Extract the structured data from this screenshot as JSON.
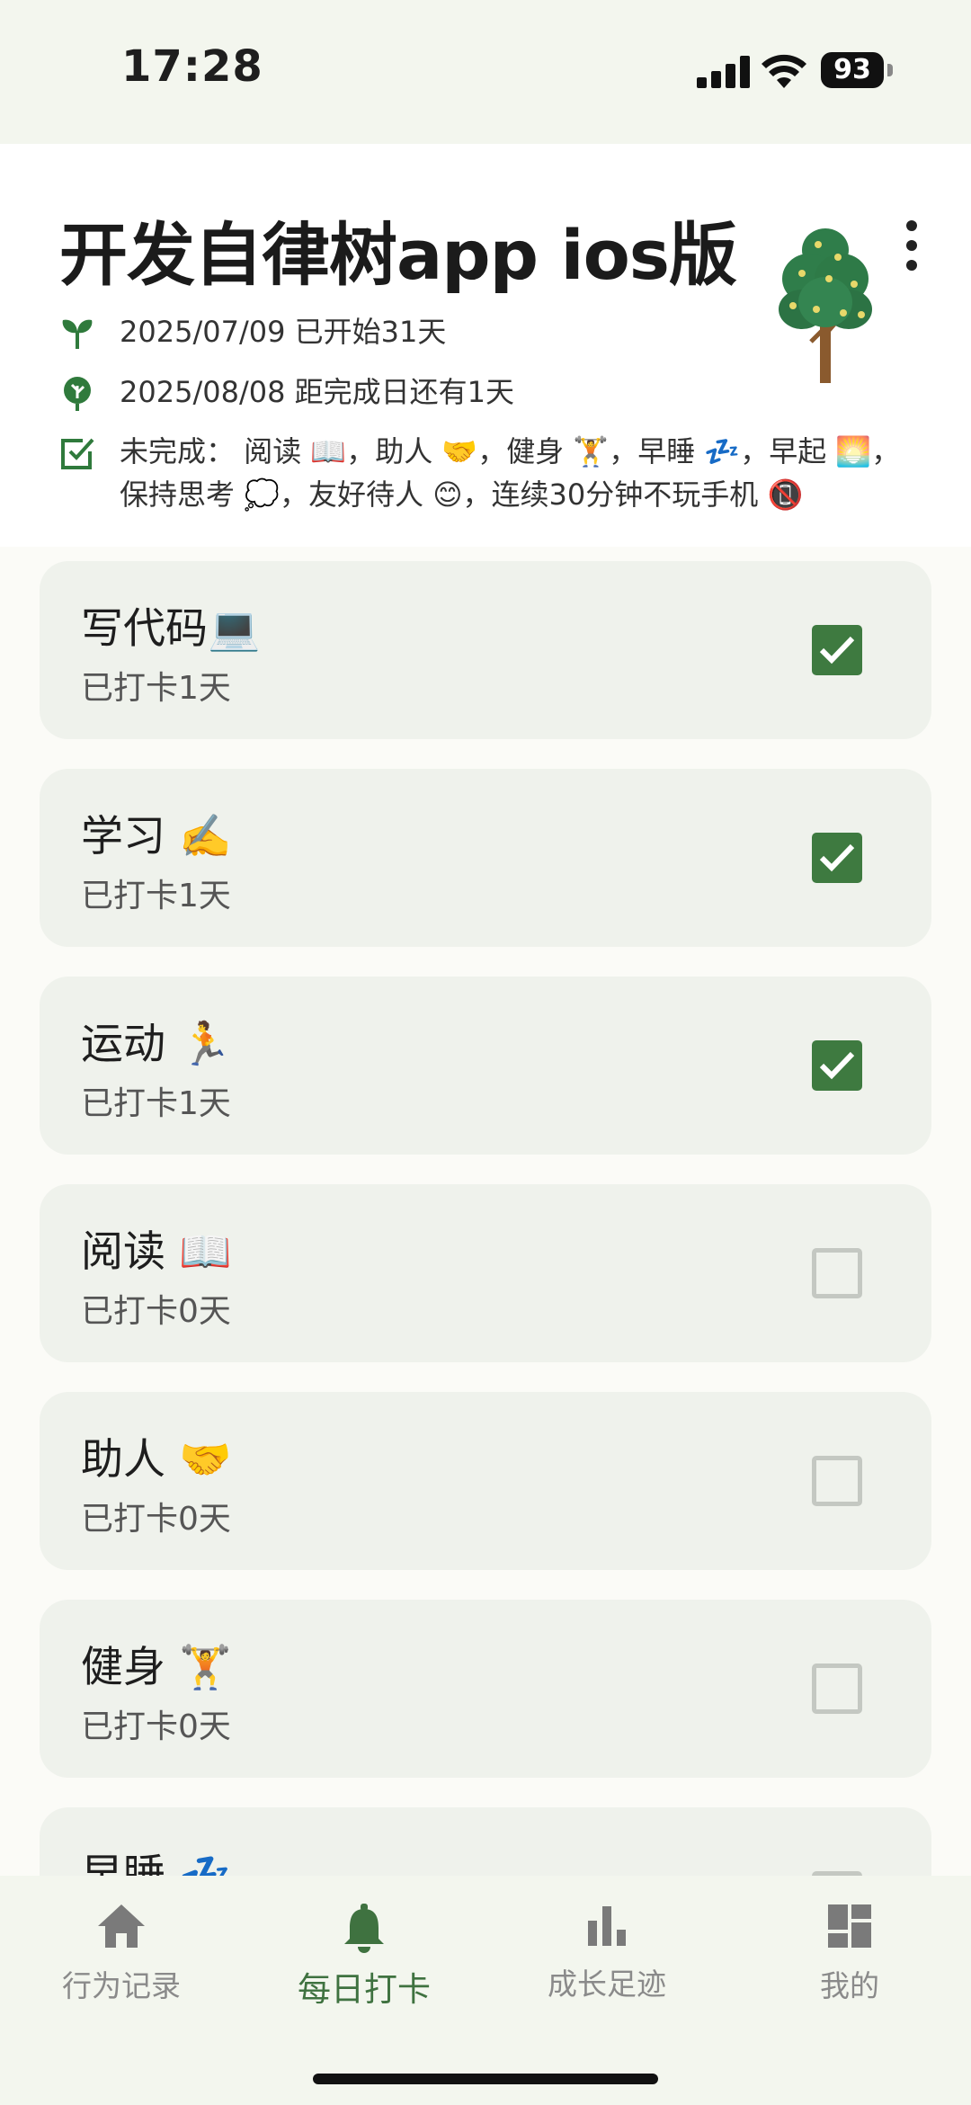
{
  "status": {
    "time": "17:28",
    "battery": "93"
  },
  "header": {
    "title": "开发自律树app ios版",
    "start_line": "2025/07/09 已开始31天",
    "end_line": "2025/08/08 距完成日还有1天",
    "incomplete_label": "未完成：",
    "incomplete_items": "阅读 📖，助人 🤝，健身 🏋️，早睡 💤，早起 🌅，保持思考 💭，友好待人 😊，连续30分钟不玩手机 📵"
  },
  "habits": [
    {
      "name": "写代码💻",
      "days": "已打卡1天",
      "checked": true
    },
    {
      "name": "学习 ✍️",
      "days": "已打卡1天",
      "checked": true
    },
    {
      "name": "运动 🏃",
      "days": "已打卡1天",
      "checked": true
    },
    {
      "name": "阅读 📖",
      "days": "已打卡0天",
      "checked": false
    },
    {
      "name": "助人 🤝",
      "days": "已打卡0天",
      "checked": false
    },
    {
      "name": "健身 🏋️",
      "days": "已打卡0天",
      "checked": false
    },
    {
      "name": "早睡 💤",
      "days": "",
      "checked": false
    }
  ],
  "nav": {
    "items": [
      {
        "label": "行为记录",
        "icon": "home-icon"
      },
      {
        "label": "每日打卡",
        "icon": "bell-icon"
      },
      {
        "label": "成长足迹",
        "icon": "bar-chart-icon"
      },
      {
        "label": "我的",
        "icon": "dashboard-icon"
      }
    ],
    "active_index": 1
  },
  "colors": {
    "accent": "#3f7240",
    "checkbox_on": "#3e7a40",
    "card_bg": "#eff2ec",
    "header_bg": "#ffffff",
    "page_bg": "#f3f6ee"
  }
}
